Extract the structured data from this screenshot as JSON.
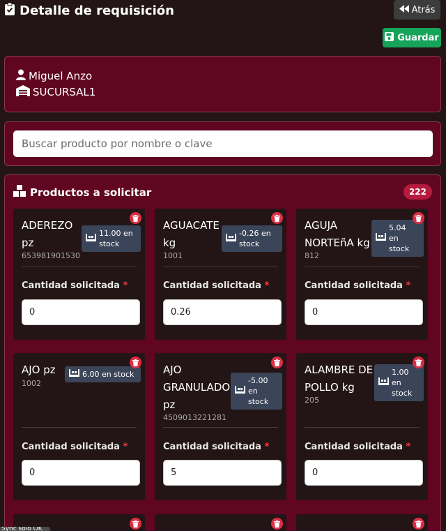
{
  "header": {
    "title": "Detalle de requisición",
    "back_label": "Atrás",
    "save_label": "Guardar"
  },
  "user": {
    "name": "Miguel Anzo",
    "branch": "SUCURSAL1"
  },
  "search": {
    "placeholder": "Buscar producto por nombre o clave",
    "value": ""
  },
  "products": {
    "title": "Productos a solicitar",
    "count": "222",
    "quantity_label": "Cantidad solicitada",
    "required_mark": "*",
    "items": [
      {
        "name": "ADEREZO pz",
        "code": "653981901530",
        "stock_value": "11.00 en",
        "stock_unit": "stock",
        "quantity": "0"
      },
      {
        "name": "AGUACATE kg",
        "code": "1001",
        "stock_value": "-0.26 en",
        "stock_unit": "stock",
        "quantity": "0.26"
      },
      {
        "name": "AGUJA NORTEñA kg",
        "code": "812",
        "stock_value": "5.04",
        "stock_unit": "en stock",
        "quantity": "0"
      },
      {
        "name": "AJO pz",
        "code": "1002",
        "stock_value": "6.00 en stock",
        "stock_unit": "",
        "quantity": "0"
      },
      {
        "name": "AJO GRANULADO pz",
        "code": "4509013221281",
        "stock_value": "-5.00",
        "stock_unit": "en stock",
        "quantity": "5"
      },
      {
        "name": "ALAMBRE DE POLLO kg",
        "code": "205",
        "stock_value": "1.00",
        "stock_unit": "en stock",
        "quantity": "0"
      }
    ]
  },
  "toast": {
    "text": "Sync solo OK"
  }
}
